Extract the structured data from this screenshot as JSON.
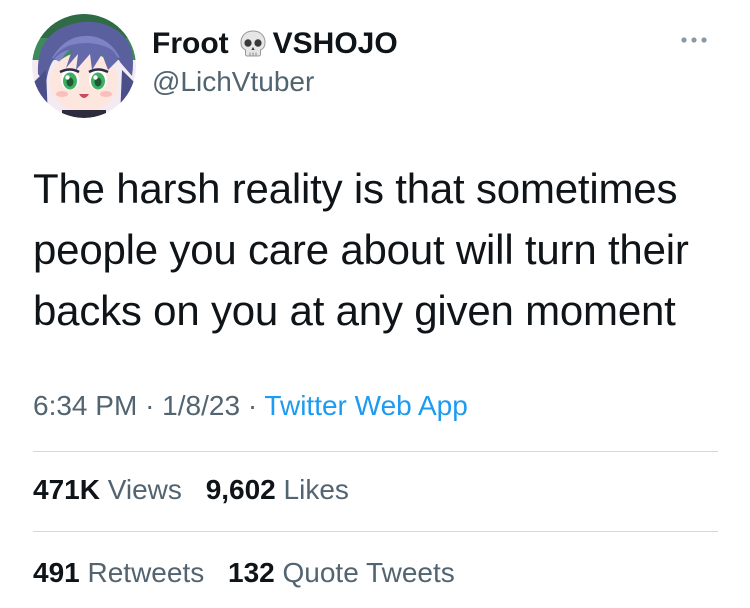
{
  "header": {
    "display_name": "Froot",
    "emoji_icon": "skull-icon",
    "name_suffix": "VSHOJO",
    "handle": "@LichVtuber",
    "more_icon": "more-dots-icon"
  },
  "tweet": {
    "text": "The harsh reality is that sometimes people you care about will turn their backs on you at any given moment"
  },
  "meta": {
    "time": "6:34 PM",
    "separator": "·",
    "date": "1/8/23",
    "source": "Twitter Web App"
  },
  "stats": {
    "views_count": "471K",
    "views_label": "Views",
    "likes_count": "9,602",
    "likes_label": "Likes",
    "retweets_count": "491",
    "retweets_label": "Retweets",
    "quotes_count": "132",
    "quotes_label": "Quote Tweets"
  },
  "colors": {
    "text": "#0f1419",
    "secondary": "#536471",
    "link": "#1d9bf0",
    "divider": "#cfd9de"
  }
}
